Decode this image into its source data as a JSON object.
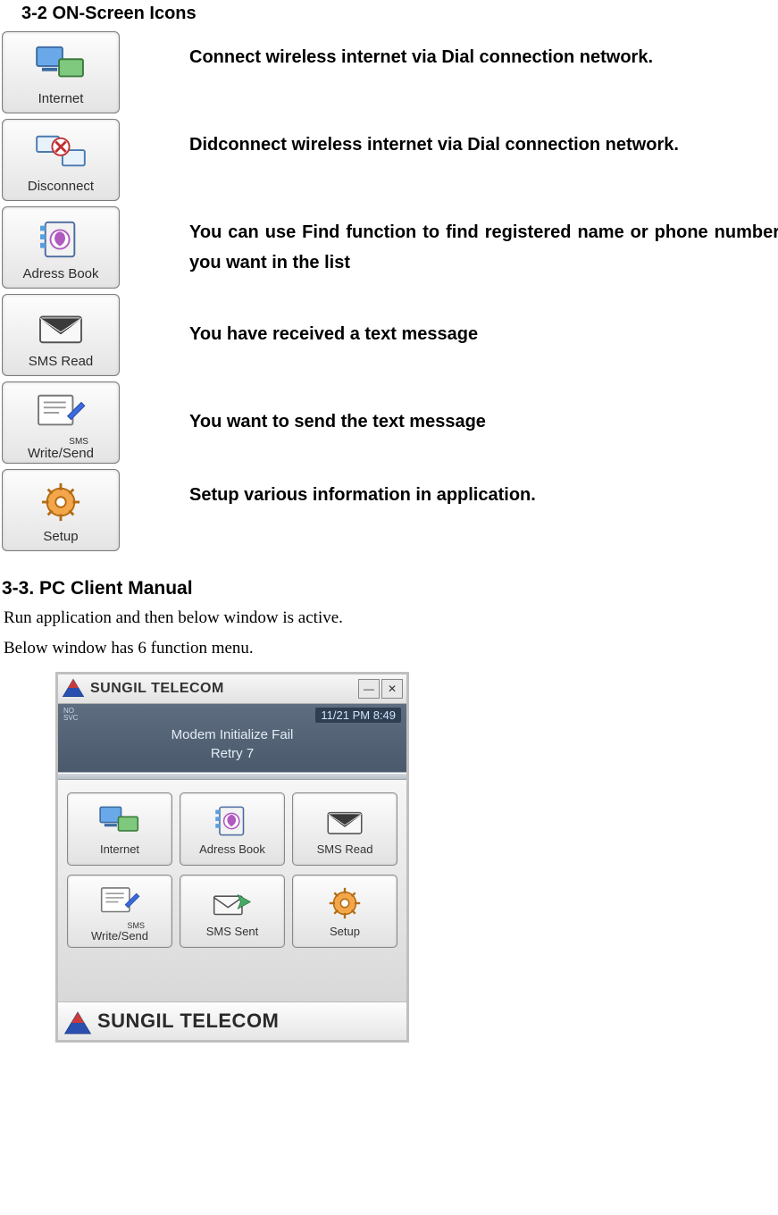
{
  "sec32_title": "3-2 ON-Screen Icons",
  "icons": [
    {
      "label": "Internet",
      "desc": "Connect wireless internet via Dial connection network."
    },
    {
      "label": "Disconnect",
      "desc": "Didconnect wireless internet via Dial connection network."
    },
    {
      "label": "Adress Book",
      "desc": "You can use Find function to find registered name or phone number you want in the list"
    },
    {
      "label": "SMS Read",
      "desc": "You have received a text message"
    },
    {
      "label": "Write/Send",
      "desc": "You want to send the text message",
      "sublabel": "SMS"
    },
    {
      "label": "Setup",
      "desc": "Setup various information in application."
    }
  ],
  "sec33_title": "3-3. PC Client Manual",
  "body_lines": [
    "Run application and then below window is active.",
    "Below window has 6 function menu."
  ],
  "app": {
    "title": "SUNGIL TELECOM",
    "no_svc": "NO SVC",
    "clock": "11/21 PM 8:49",
    "status_line1": "Modem Initialize Fail",
    "status_line2": "Retry 7",
    "menu": [
      {
        "label": "Internet"
      },
      {
        "label": "Adress Book"
      },
      {
        "label": "SMS Read"
      },
      {
        "label": "Write/Send",
        "sublabel": "SMS"
      },
      {
        "label": "SMS Sent"
      },
      {
        "label": "Setup"
      }
    ],
    "footer": "SUNGIL TELECOM"
  }
}
